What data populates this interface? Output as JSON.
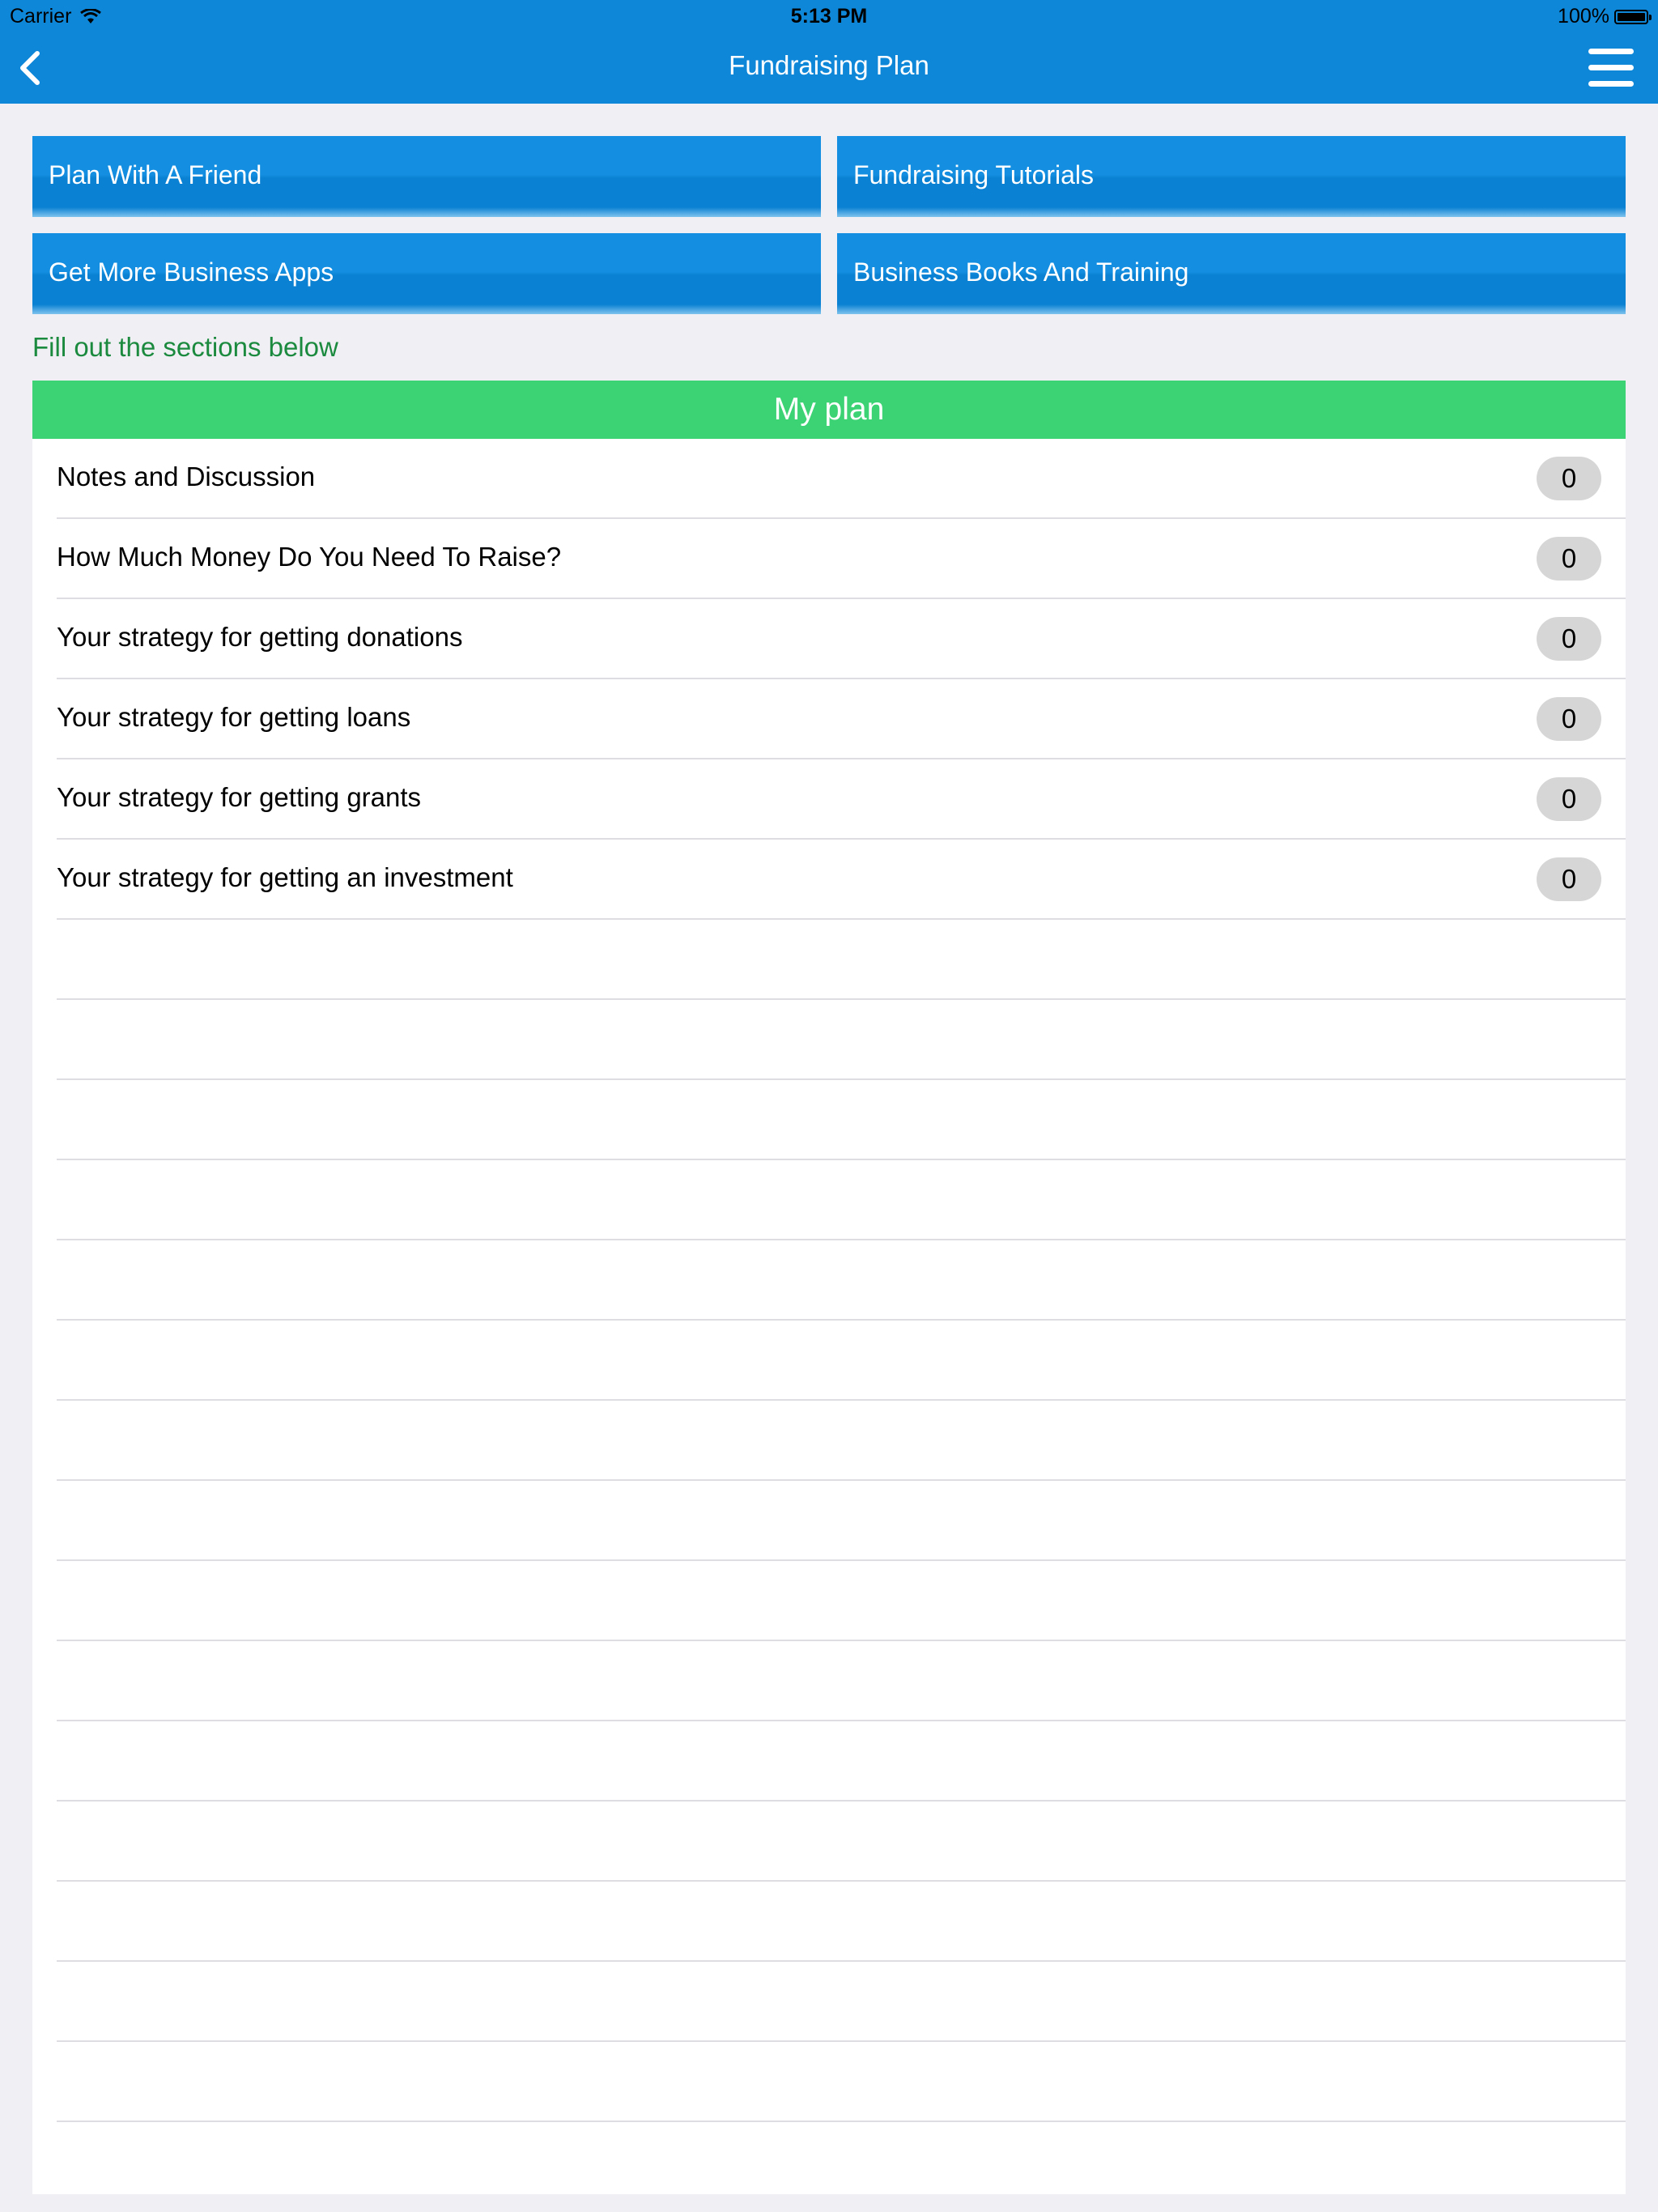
{
  "status_bar": {
    "carrier": "Carrier",
    "time": "5:13 PM",
    "battery": "100%"
  },
  "nav": {
    "title": "Fundraising Plan",
    "back_icon": "chevron-left-icon",
    "menu_icon": "hamburger-menu-icon"
  },
  "buttons": [
    {
      "label": "Plan With A Friend"
    },
    {
      "label": "Fundraising Tutorials"
    },
    {
      "label": "Get More Business Apps"
    },
    {
      "label": "Business Books And Training"
    }
  ],
  "hint": "Fill out the sections below",
  "plan": {
    "header": "My plan",
    "items": [
      {
        "label": "Notes and Discussion",
        "count": "0"
      },
      {
        "label": "How Much Money Do You Need To Raise?",
        "count": "0"
      },
      {
        "label": "Your strategy for getting donations",
        "count": "0"
      },
      {
        "label": "Your strategy for getting loans",
        "count": "0"
      },
      {
        "label": "Your strategy for getting grants",
        "count": "0"
      },
      {
        "label": "Your strategy for getting an investment",
        "count": "0"
      }
    ]
  },
  "colors": {
    "nav_blue": "#0f87d9",
    "header_green": "#3cd374",
    "hint_green": "#1b8a3e",
    "background": "#efeff4"
  }
}
